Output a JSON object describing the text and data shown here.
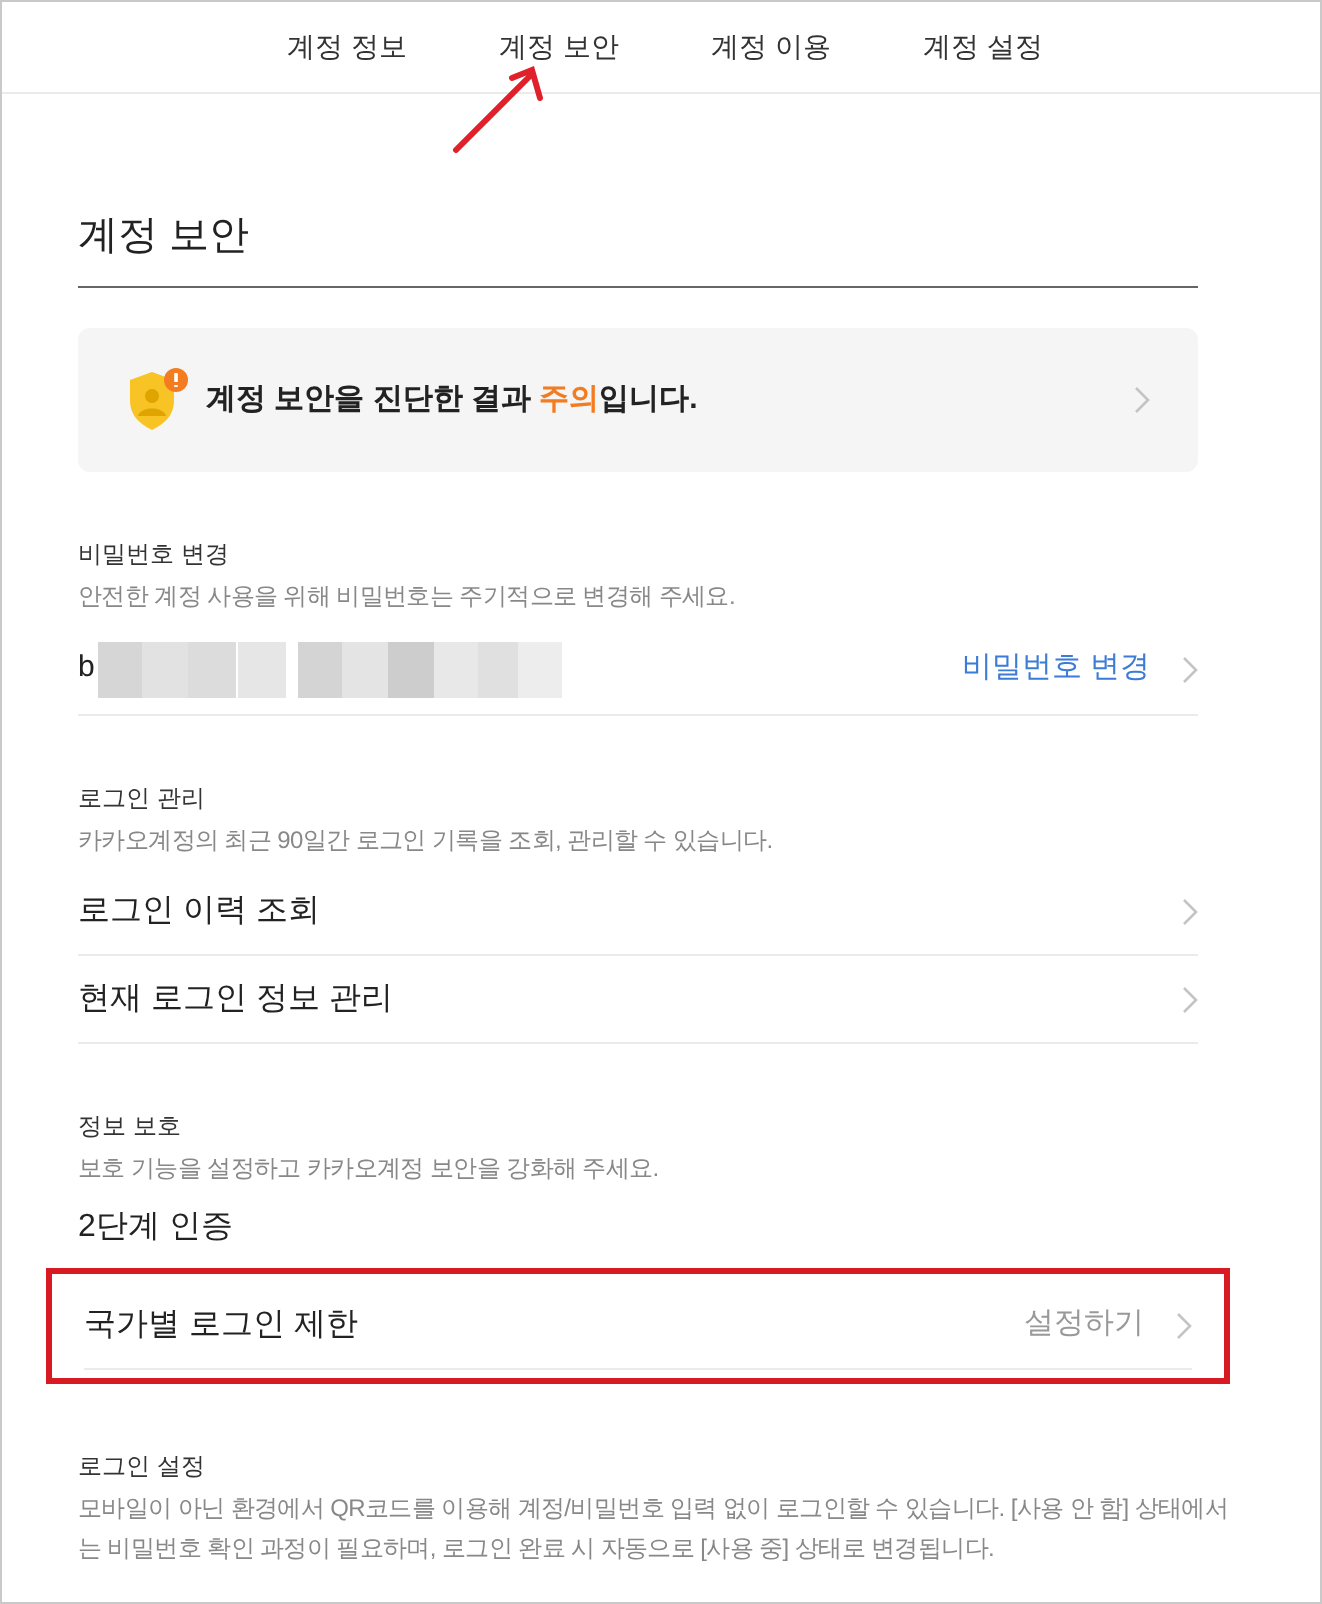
{
  "tabs": [
    {
      "label": "계정 정보",
      "selected": false
    },
    {
      "label": "계정 보안",
      "selected": false
    },
    {
      "label": "계정 이용",
      "selected": false
    },
    {
      "label": "계정 설정",
      "selected": false
    }
  ],
  "page_title": "계정 보안",
  "diagnosis": {
    "text": "계정 보안을 진단한 결과 **주의**입니다."
  },
  "sections": [
    {
      "title": "비밀번호 변경",
      "description": "안전한 계정 사용을 위해 비밀번호는 주기적으로 변경해 주세요.",
      "items": [
        {
          "kind": "password",
          "label": "b",
          "action": "비밀번호 변경"
        }
      ]
    },
    {
      "title": "로그인 관리",
      "description": "카카오계정의 최근 90일간 로그인 기록을 조회, 관리할 수 있습니다.",
      "items": [
        {
          "kind": "link",
          "label": "로그인 이력 조회"
        },
        {
          "kind": "link",
          "label": "현재 로그인 정보 관리"
        }
      ]
    },
    {
      "title": "정보 보호",
      "description": "보호 기능을 설정하고 카카오계정 보안을 강화해 주세요.",
      "items": [
        {
          "kind": "heading",
          "label": "2단계 인증"
        },
        {
          "kind": "setting",
          "label": "국가별 로그인 제한",
          "action": "설정하기",
          "highlighted": true
        }
      ]
    },
    {
      "title": "로그인 설정",
      "description": "모바일이 아닌 환경에서 QR코드를 이용해 계정/비밀번호 입력 없이 로그인할 수 있습니다. [사용 안 함] 상태에서는 비밀번호 확인 과정이 필요하며, 로그인 완료 시 자동으로 [사용 중] 상태로 변경됩니다."
    }
  ]
}
